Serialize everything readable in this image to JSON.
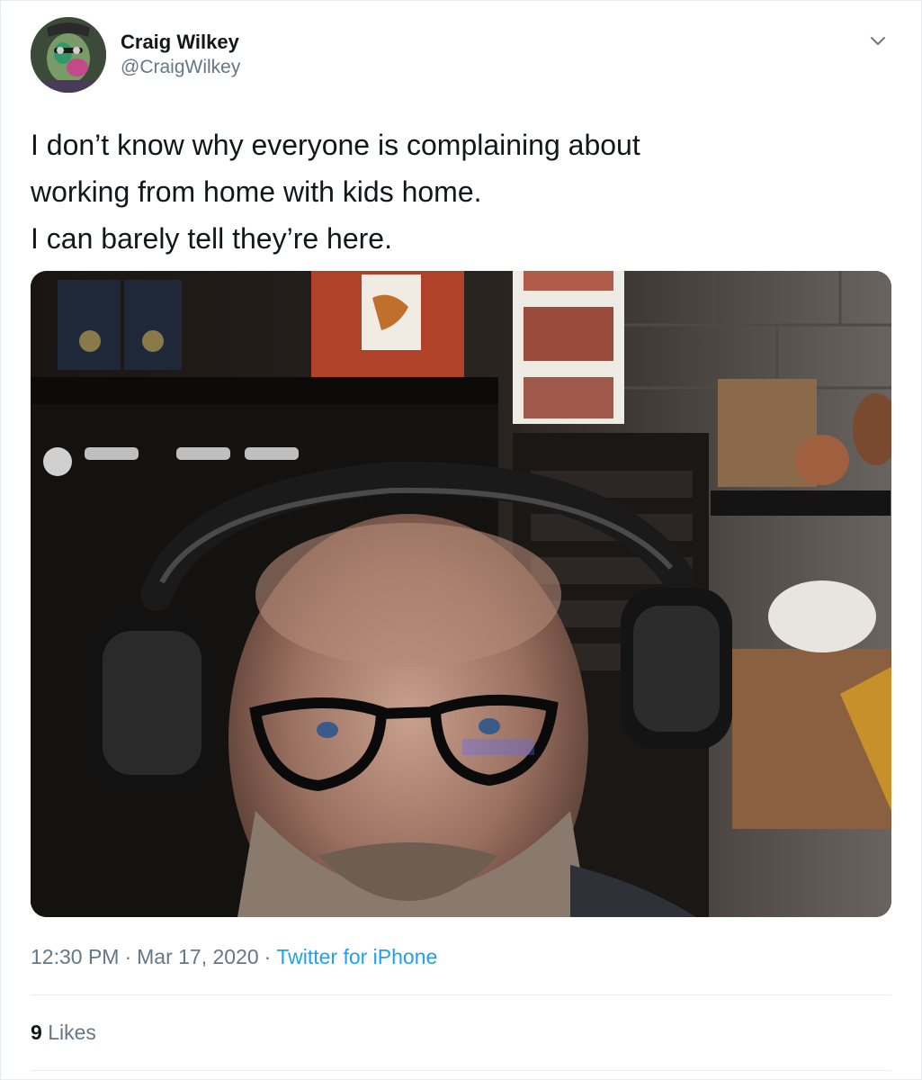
{
  "author": {
    "display_name": "Craig Wilkey",
    "handle": "@CraigWilkey",
    "avatar_icon": "avatar-photo"
  },
  "menu": {
    "icon": "chevron-down-icon"
  },
  "tweet": {
    "text_lines": [
      "I don’t know why everyone is complaining about",
      "working from home with kids home.",
      "I can barely tell they’re here."
    ],
    "photo_description_icon": "attached-photo"
  },
  "meta": {
    "time": "12:30 PM",
    "separator": "·",
    "date": "Mar 17, 2020",
    "source": "Twitter for iPhone"
  },
  "stats": {
    "likes_count": "9",
    "likes_label": "Likes"
  },
  "colors": {
    "text_primary": "#14171a",
    "text_secondary": "#657786",
    "link": "#1da1f2",
    "divider": "#e6ecf0"
  }
}
